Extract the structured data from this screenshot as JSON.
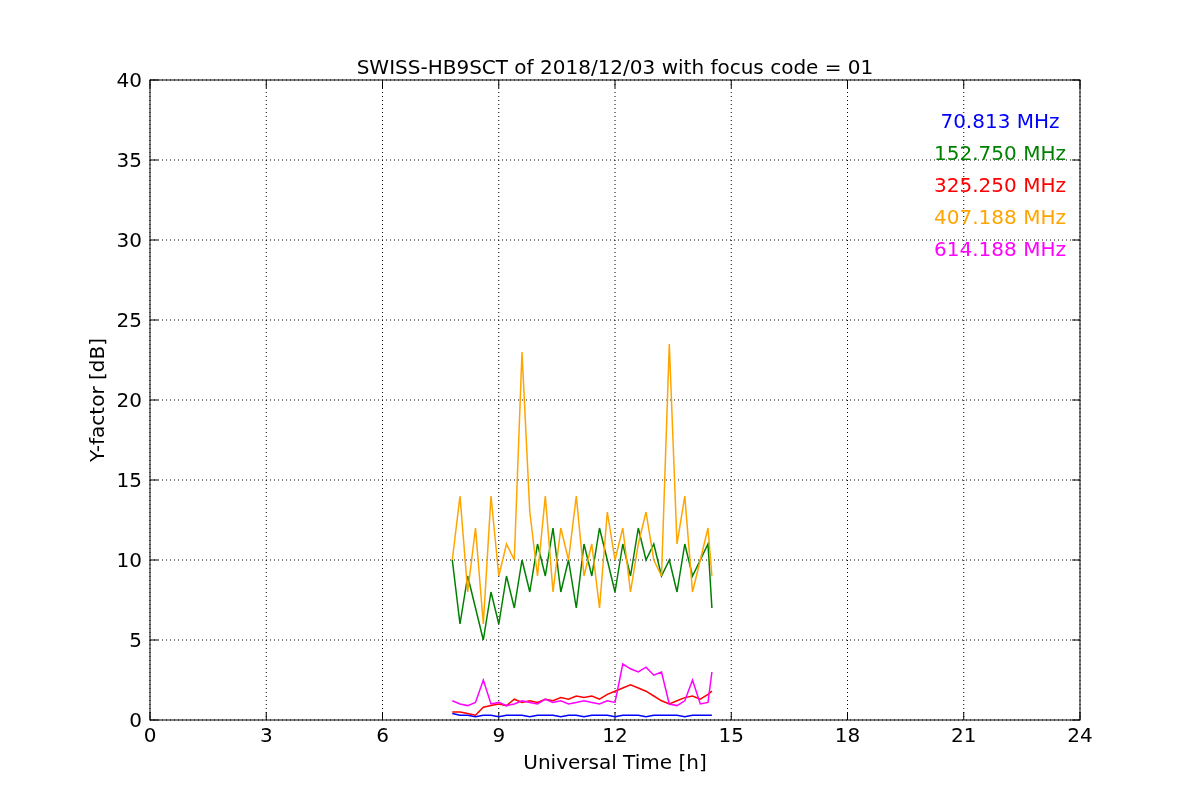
{
  "chart_data": {
    "type": "line",
    "title": "SWISS-HB9SCT of 2018/12/03 with focus code = 01",
    "xlabel": "Universal Time [h]",
    "ylabel": "Y-factor [dB]",
    "x": [
      7.8,
      8,
      8.2,
      8.4,
      8.6,
      8.8,
      9,
      9.2,
      9.4,
      9.6,
      9.8,
      10,
      10.2,
      10.4,
      10.6,
      10.8,
      11,
      11.2,
      11.4,
      11.6,
      11.8,
      12,
      12.2,
      12.4,
      12.6,
      12.8,
      13,
      13.2,
      13.4,
      13.6,
      13.8,
      14,
      14.2,
      14.4,
      14.5
    ],
    "grid": true,
    "xlim": [
      0,
      24
    ],
    "ylim": [
      0,
      40
    ],
    "xticks": [
      0,
      3,
      6,
      9,
      12,
      15,
      18,
      21,
      24
    ],
    "yticks": [
      0,
      5,
      10,
      15,
      20,
      25,
      30,
      35,
      40
    ],
    "series": [
      {
        "name": "70.813 MHz",
        "color": "#0000ff",
        "values": [
          0.4,
          0.3,
          0.3,
          0.2,
          0.3,
          0.3,
          0.2,
          0.3,
          0.3,
          0.3,
          0.2,
          0.3,
          0.3,
          0.3,
          0.2,
          0.3,
          0.3,
          0.2,
          0.3,
          0.3,
          0.3,
          0.2,
          0.3,
          0.3,
          0.3,
          0.2,
          0.3,
          0.3,
          0.3,
          0.3,
          0.2,
          0.3,
          0.3,
          0.3,
          0.3
        ]
      },
      {
        "name": "152.750 MHz",
        "color": "#008000",
        "values": [
          10,
          6,
          9,
          7,
          5,
          8,
          6,
          9,
          7,
          10,
          8,
          11,
          9,
          12,
          8,
          10,
          7,
          11,
          9,
          12,
          10,
          8,
          11,
          9,
          12,
          10,
          11,
          9,
          10,
          8,
          11,
          9,
          10,
          11,
          7
        ]
      },
      {
        "name": "325.250 MHz",
        "color": "#ff0000",
        "values": [
          0.5,
          0.5,
          0.4,
          0.3,
          0.8,
          0.9,
          1,
          0.9,
          1.3,
          1.1,
          1.2,
          1.1,
          1.3,
          1.2,
          1.4,
          1.3,
          1.5,
          1.4,
          1.5,
          1.3,
          1.6,
          1.8,
          2,
          2.2,
          2,
          1.8,
          1.5,
          1.2,
          1,
          1.2,
          1.4,
          1.5,
          1.3,
          1.6,
          1.8
        ]
      },
      {
        "name": "407.188 MHz",
        "color": "#ffa500",
        "values": [
          10,
          14,
          8,
          12,
          6,
          14,
          9,
          11,
          10,
          23,
          13,
          9,
          14,
          8,
          12,
          10,
          14,
          9,
          11,
          7,
          13,
          10,
          12,
          8,
          11,
          13,
          10,
          9,
          23.5,
          11,
          14,
          8,
          10,
          12,
          9
        ]
      },
      {
        "name": "614.188 MHz",
        "color": "#ff00ff",
        "values": [
          1.2,
          1,
          0.9,
          1.1,
          2.5,
          1,
          1.1,
          0.9,
          1,
          1.2,
          1.1,
          1,
          1.3,
          1.1,
          1.2,
          1,
          1.1,
          1.2,
          1.1,
          1,
          1.2,
          1.1,
          3.5,
          3.2,
          3,
          3.3,
          2.8,
          3,
          1,
          0.9,
          1.2,
          2.5,
          1,
          1.1,
          3
        ]
      }
    ]
  }
}
